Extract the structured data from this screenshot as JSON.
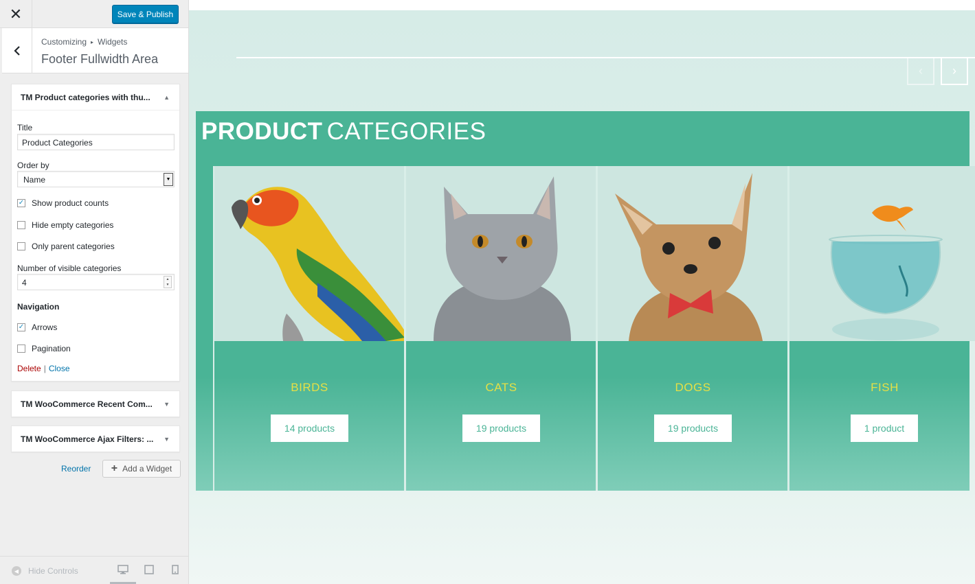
{
  "topbar": {
    "close_icon": "close-icon",
    "save_label": "Save & Publish"
  },
  "section": {
    "breadcrumb_root": "Customizing",
    "breadcrumb_sep": "▸",
    "breadcrumb_child": "Widgets",
    "title": "Footer Fullwidth Area"
  },
  "widget1": {
    "title": "TM Product categories with thu...",
    "form": {
      "title_label": "Title",
      "title_value": "Product Categories",
      "order_label": "Order by",
      "order_value": "Name",
      "show_counts_label": "Show product counts",
      "show_counts_checked": true,
      "hide_empty_label": "Hide empty categories",
      "hide_empty_checked": false,
      "only_parent_label": "Only parent categories",
      "only_parent_checked": false,
      "visible_label": "Number of visible categories",
      "visible_value": "4",
      "navigation_heading": "Navigation",
      "arrows_label": "Arrows",
      "arrows_checked": true,
      "pagination_label": "Pagination",
      "pagination_checked": false,
      "delete_label": "Delete",
      "link_sep": "|",
      "close_label": "Close"
    }
  },
  "widget2": {
    "title": "TM WooCommerce Recent Com..."
  },
  "widget3": {
    "title": "TM WooCommerce Ajax Filters: ..."
  },
  "actions": {
    "reorder_label": "Reorder",
    "add_widget_label": "Add a Widget"
  },
  "footer": {
    "hide_controls_label": "Hide Controls",
    "devices": [
      "desktop-icon",
      "tablet-icon",
      "mobile-icon"
    ]
  },
  "preview": {
    "heading_bold": "PRODUCT",
    "heading_light": "CATEGORIES",
    "categories": [
      {
        "name": "BIRDS",
        "count": "14 products",
        "image": "parrot"
      },
      {
        "name": "CATS",
        "count": "19 products",
        "image": "cat"
      },
      {
        "name": "DOGS",
        "count": "19 products",
        "image": "dog"
      },
      {
        "name": "FISH",
        "count": "1 product",
        "image": "goldfish-bowl"
      }
    ],
    "colors": {
      "accent": "#4ab496",
      "category_name": "#e6e045",
      "save_button": "#0085ba"
    }
  }
}
